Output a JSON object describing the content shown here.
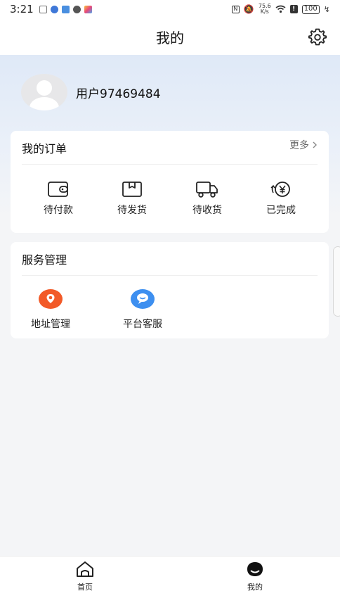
{
  "status_bar": {
    "time": "3:21",
    "network_speed_value": "75.6",
    "network_speed_unit": "K/s",
    "battery": "100"
  },
  "header": {
    "title": "我的",
    "settings_icon": "gear-icon"
  },
  "profile": {
    "username": "用户97469484",
    "avatar_icon": "default-avatar-icon"
  },
  "orders": {
    "title": "我的订单",
    "more_label": "更多",
    "items": [
      {
        "label": "待付款",
        "icon": "wallet-icon"
      },
      {
        "label": "待发货",
        "icon": "package-box-icon"
      },
      {
        "label": "待收货",
        "icon": "delivery-truck-icon"
      },
      {
        "label": "已完成",
        "icon": "yuan-coin-icon"
      }
    ]
  },
  "services": {
    "title": "服务管理",
    "items": [
      {
        "label": "地址管理",
        "icon": "location-pin-icon",
        "color": "#f25a28"
      },
      {
        "label": "平台客服",
        "icon": "chat-bubble-icon",
        "color": "#3d8ff0"
      }
    ]
  },
  "tabbar": {
    "items": [
      {
        "label": "首页",
        "icon": "home-icon"
      },
      {
        "label": "我的",
        "icon": "profile-icon"
      }
    ]
  }
}
